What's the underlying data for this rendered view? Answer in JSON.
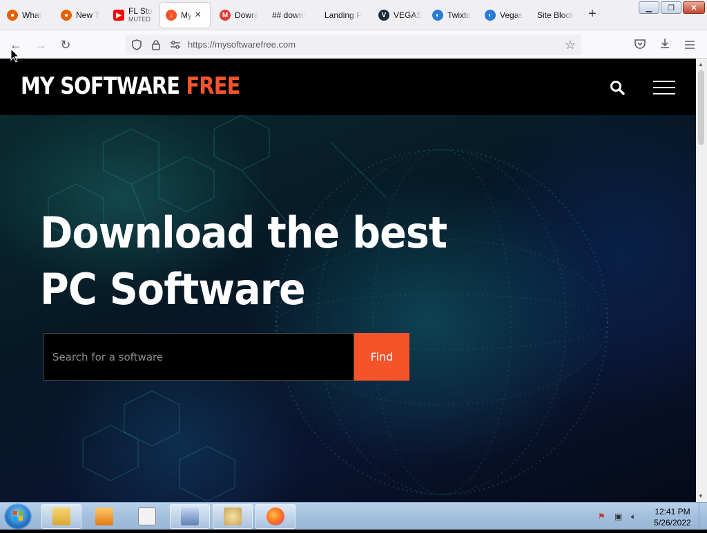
{
  "tabs": [
    {
      "label": "What",
      "favicon": "firefox-icon",
      "color": "#e66000"
    },
    {
      "label": "New T",
      "favicon": "firefox-icon",
      "color": "#e66000"
    },
    {
      "label": "FL Stu",
      "sublabel": "MUTED",
      "favicon": "youtube-icon",
      "color": "#ff0000"
    },
    {
      "label": "My",
      "favicon": "download-icon",
      "color": "#f5542b",
      "active": true
    },
    {
      "label": "Downl",
      "favicon": "m-icon",
      "color": "#e53935"
    },
    {
      "label": "## downl",
      "favicon": "none"
    },
    {
      "label": "Landing P",
      "favicon": "none"
    },
    {
      "label": "VEGAS",
      "favicon": "v-icon",
      "color": "#1b2a3a"
    },
    {
      "label": "Twixto",
      "favicon": "twixtor-icon",
      "color": "#2a7bd6"
    },
    {
      "label": "Vegas",
      "favicon": "vegas-icon",
      "color": "#2a7bd6"
    },
    {
      "label": "Site Block",
      "favicon": "none"
    }
  ],
  "nav": {
    "url": "https://mysoftwarefree.com"
  },
  "site": {
    "logo_main": "MY SOFTWARE ",
    "logo_accent": "FREE",
    "heading_line1": "Download the best",
    "heading_line2": "PC Software",
    "search_placeholder": "Search for a software",
    "find_label": "Find",
    "accent_color": "#f5542b"
  },
  "taskbar": {
    "items": [
      "explorer-icon",
      "media-player-icon",
      "notepad-icon",
      "app-icon",
      "paint-icon",
      "firefox-icon"
    ],
    "time": "12:41 PM",
    "date": "5/26/2022"
  }
}
